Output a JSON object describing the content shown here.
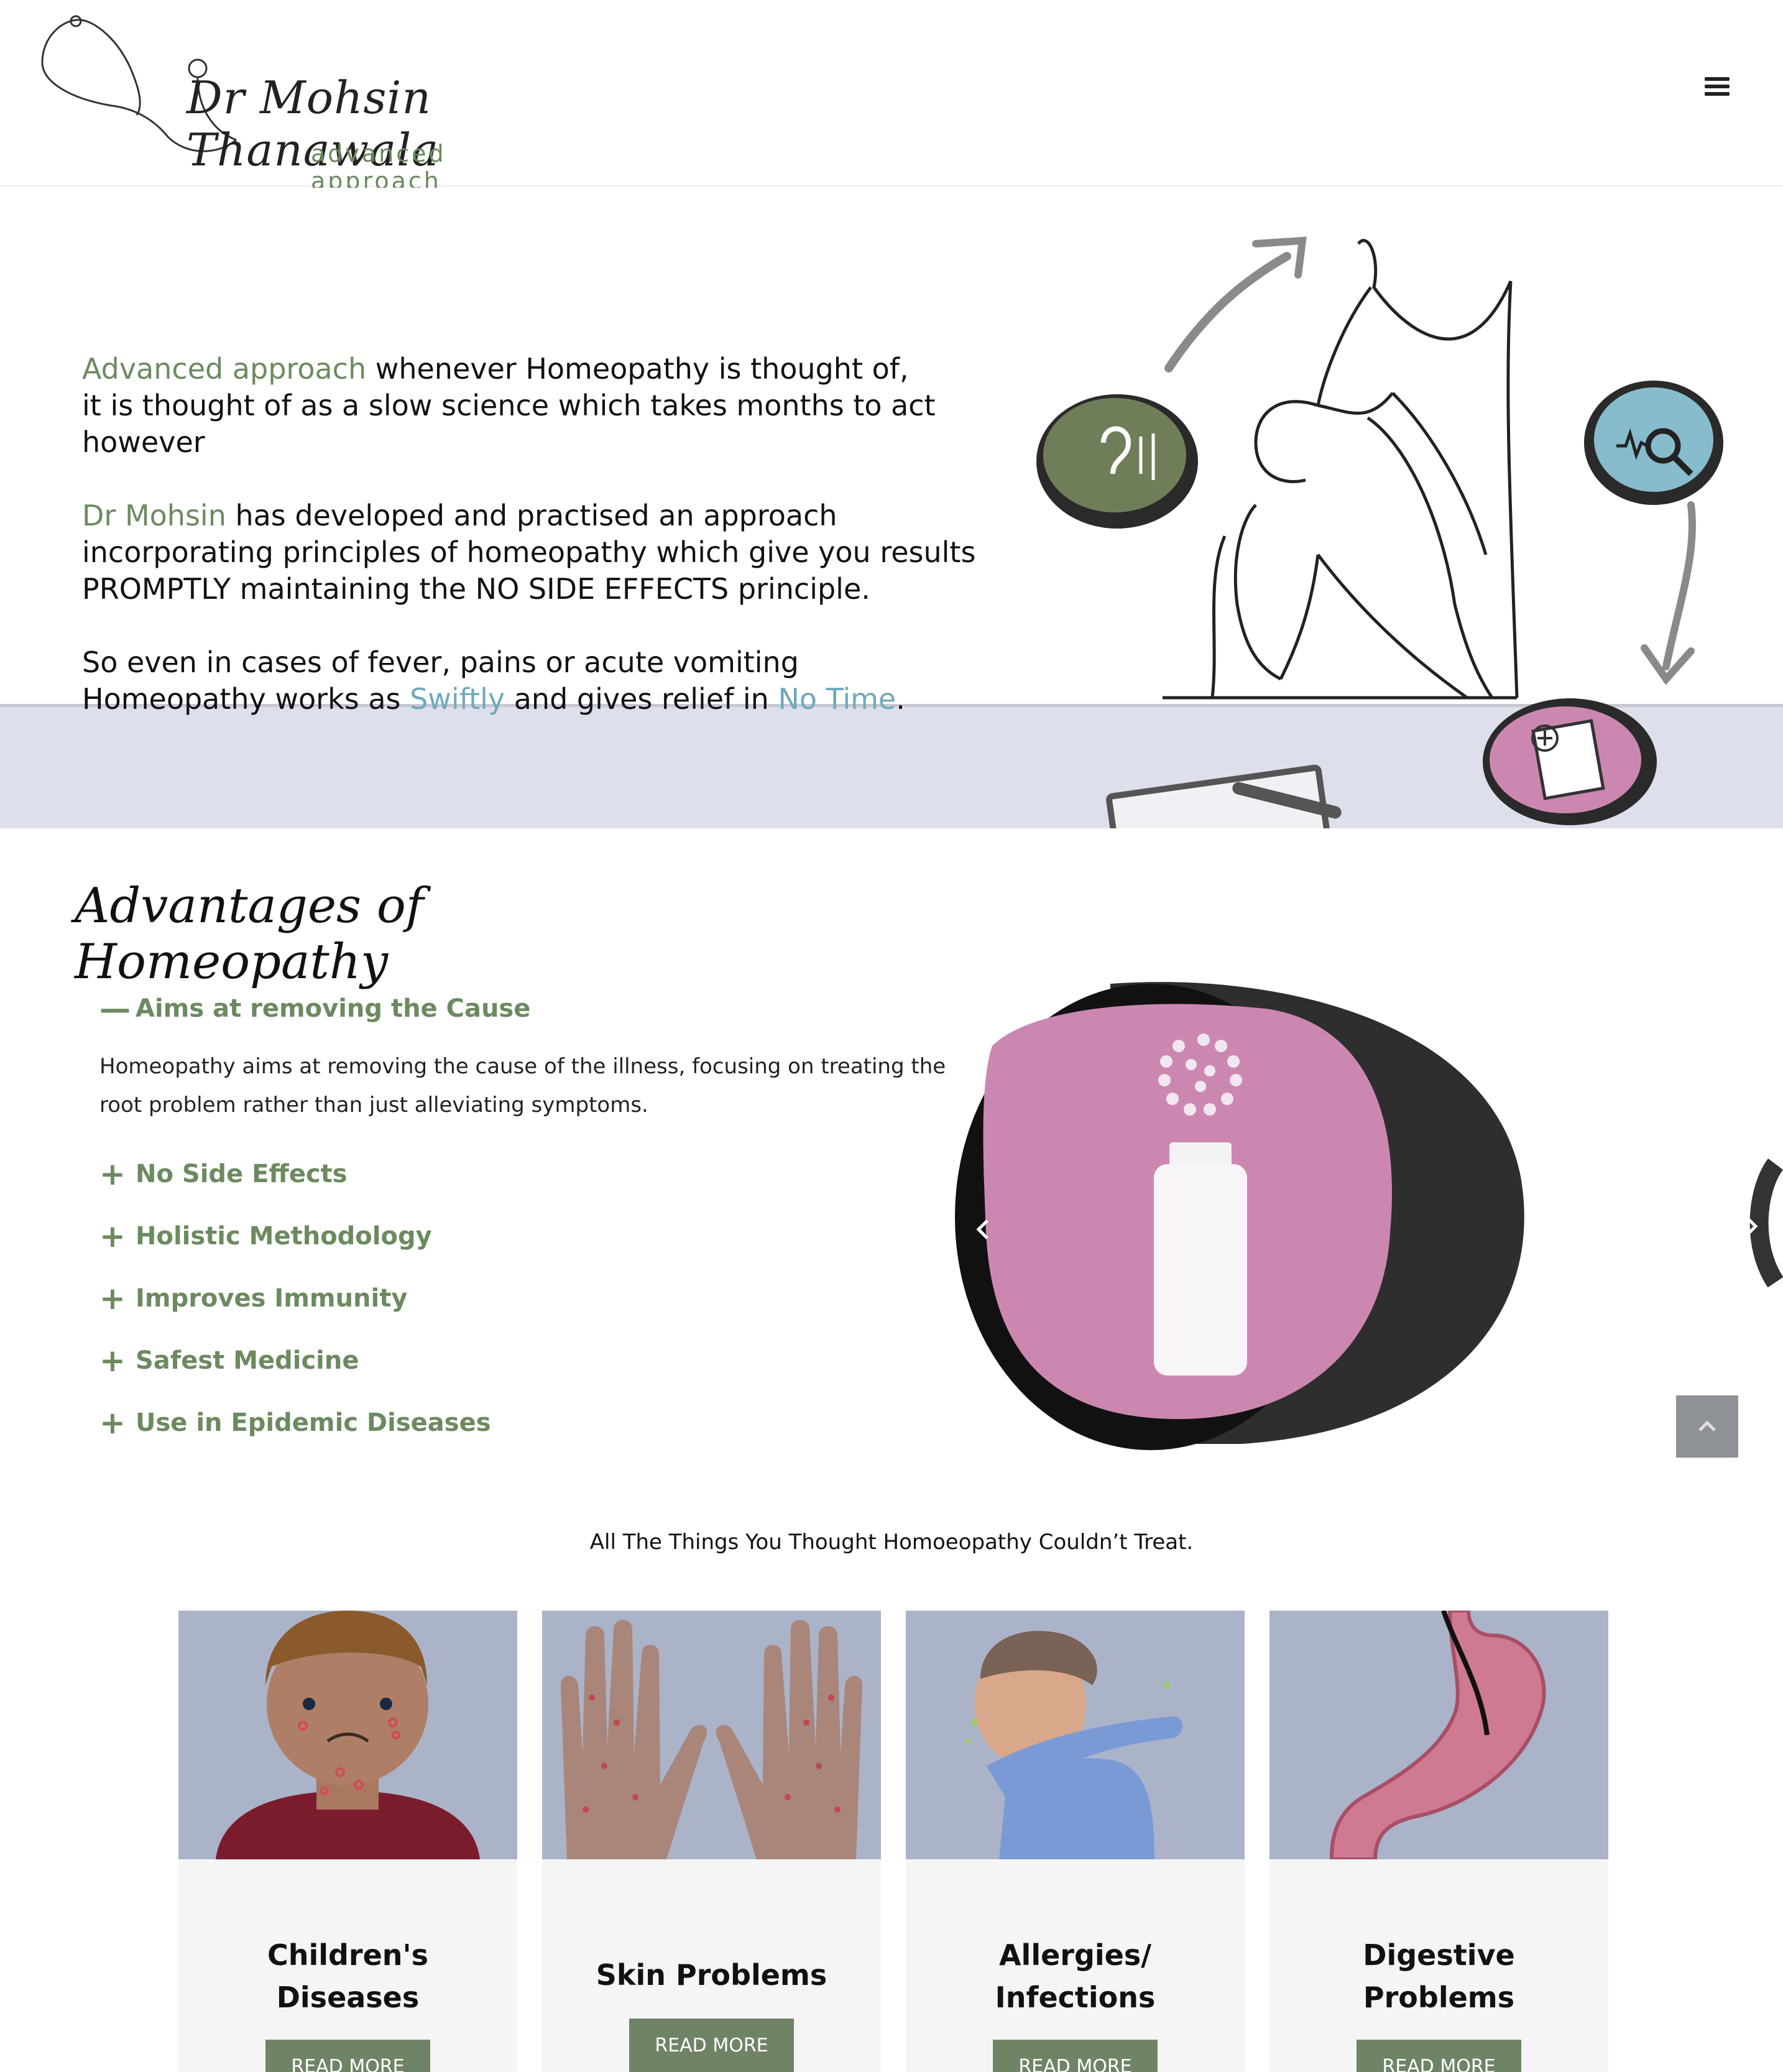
{
  "header": {
    "logo_name": "Dr Mohsin Thanawala",
    "logo_tagline": "advanced approach",
    "menu_icon": "hamburger-menu-icon"
  },
  "hero": {
    "p1_highlight": "Advanced approach",
    "p1_rest": " whenever Homeopathy is thought of,",
    "p1_line2": "it is thought of as a slow science which takes months to act however",
    "p2_highlight": "Dr Mohsin",
    "p2_rest": " has developed and practised an approach",
    "p2_line2": "incorporating principles of homeopathy which give you results",
    "p2_line3a": "PROMPTLY",
    "p2_line3b": " maintaining the ",
    "p2_line3c": "NO SIDE EFFECTS",
    "p2_line3d": " principle.",
    "p3_line1": "So even in cases of fever, pains or acute vomiting",
    "p3_line2a": "Homeopathy works as ",
    "p3_swiftly": "Swiftly",
    "p3_line2b": " and gives relief in ",
    "p3_notime": "No Time",
    "p3_end": "."
  },
  "advantages": {
    "title": "Advantages of Homeopathy",
    "items": [
      {
        "label": "Aims at removing the Cause",
        "sign": "—",
        "open": true,
        "body": "Homeopathy aims at removing the cause of the illness, focusing on treating the root problem rather than just alleviating symptoms."
      },
      {
        "label": "No Side Effects",
        "sign": "+"
      },
      {
        "label": "Holistic Methodology",
        "sign": "+"
      },
      {
        "label": "Improves Immunity",
        "sign": "+"
      },
      {
        "label": "Safest Medicine",
        "sign": "+"
      },
      {
        "label": "Use in Epidemic Diseases",
        "sign": "+"
      }
    ]
  },
  "treatments": {
    "heading": "All The Things You Thought Homoeopathy Couldn’t Treat.",
    "cards": [
      {
        "title1": "Children's",
        "title2": "Diseases",
        "button": "READ MORE"
      },
      {
        "title1": "Skin Problems",
        "title2": "",
        "button": "READ MORE"
      },
      {
        "title1": "Allergies/",
        "title2": "Infections",
        "button": "READ MORE"
      },
      {
        "title1": "Digestive",
        "title2": "Problems",
        "button": "READ MORE"
      }
    ]
  },
  "colors": {
    "accent_green": "#6c8a5f",
    "accent_blue": "#6fa9bc",
    "button_green": "#6f8466",
    "card_image_bg": "#aab3c8",
    "pink": "#cc87b1"
  }
}
